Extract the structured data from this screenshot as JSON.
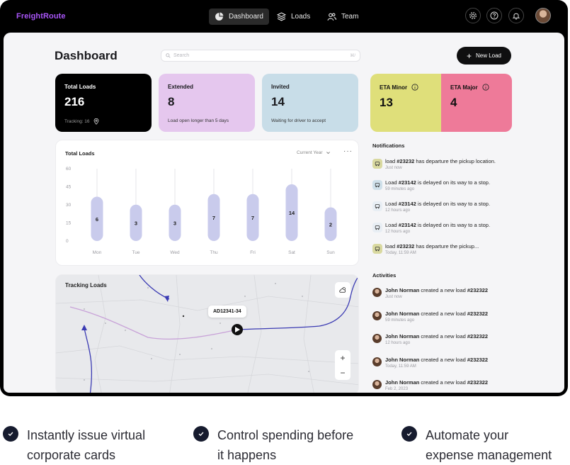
{
  "nav": {
    "brand": "FreightRoute",
    "tabs": [
      {
        "label": "Dashboard",
        "icon": "pie-chart-icon",
        "active": true
      },
      {
        "label": "Loads",
        "icon": "layers-icon",
        "active": false
      },
      {
        "label": "Team",
        "icon": "users-icon",
        "active": false
      }
    ],
    "icons": [
      "gear-icon",
      "help-icon",
      "bell-icon"
    ]
  },
  "header": {
    "title": "Dashboard",
    "search_placeholder": "Search",
    "search_shortcut": "⌘/",
    "new_load_label": "New Load"
  },
  "stats": [
    {
      "label": "Total Loads",
      "value": "216",
      "sub": "Tracking: 16",
      "bg": "#000000",
      "fg": "#ffffff"
    },
    {
      "label": "Extended",
      "value": "8",
      "sub": "Load open longer than 5 days",
      "bg": "#e5c7ee",
      "fg": "#1b1b1f"
    },
    {
      "label": "Invited",
      "value": "14",
      "sub": "Waiting for driver to accept",
      "bg": "#c8dde8",
      "fg": "#1b1b1f"
    }
  ],
  "eta": [
    {
      "label": "ETA Minor",
      "value": "13",
      "bg": "#dfdf7a"
    },
    {
      "label": "ETA Major",
      "value": "4",
      "bg": "#ee7a99"
    }
  ],
  "total_loads_chart": {
    "title": "Total Loads",
    "filter": "Current Year",
    "more": "···"
  },
  "chart_data": {
    "type": "bar",
    "title": "Total Loads",
    "categories": [
      "Mon",
      "Tue",
      "Wed",
      "Thu",
      "Fri",
      "Sat",
      "Sun"
    ],
    "values": [
      6,
      3,
      3,
      7,
      7,
      14,
      2
    ],
    "yticks": [
      0,
      15,
      30,
      45,
      60
    ],
    "ylim": [
      0,
      60
    ],
    "bar_color": "#c9cbec",
    "grid": false
  },
  "map": {
    "title": "Tracking Loads",
    "tooltip": "AD12341-34",
    "zoom_in": "+",
    "zoom_out": "−"
  },
  "notifications": {
    "title": "Notifications",
    "items": [
      {
        "pre": "load ",
        "id": "#23232",
        "post": " has departure the pickup location.",
        "time": "Just now",
        "color": "#d9d9a0"
      },
      {
        "pre": "Load ",
        "id": "#23142",
        "post": " is delayed on its way to a stop.",
        "time": "59 minutes ago",
        "color": "#cfe0ea"
      },
      {
        "pre": "Load ",
        "id": "#23142",
        "post": " is delayed on its way to a stop.",
        "time": "12 hours ago",
        "color": "#e8eef4"
      },
      {
        "pre": "Load ",
        "id": "#23142",
        "post": " is delayed on its way to a stop.",
        "time": "12 hours ago",
        "color": "#e8eef4"
      },
      {
        "pre": "load ",
        "id": "#23232",
        "post": " has departure the pickup...",
        "time": "Today, 11:59 AM",
        "color": "#d9d9a0"
      }
    ]
  },
  "activities": {
    "title": "Activities",
    "items": [
      {
        "name": "John Norman",
        "action": " created a new load ",
        "id": "#232322",
        "time": "Just now"
      },
      {
        "name": "John Norman",
        "action": " created a new load ",
        "id": "#232322",
        "time": "59 minutes ago"
      },
      {
        "name": "John Norman",
        "action": " created a new load ",
        "id": "#232322",
        "time": "12 hours ago"
      },
      {
        "name": "John Norman",
        "action": " created a new load ",
        "id": "#232322",
        "time": "Today, 11:59 AM"
      },
      {
        "name": "John Norman",
        "action": " created a new load ",
        "id": "#232322",
        "time": "Feb 2, 2023"
      }
    ]
  },
  "features": [
    {
      "line1": "Instantly issue virtual",
      "line2": "corporate cards"
    },
    {
      "line1": "Control spending before",
      "line2": "it happens"
    },
    {
      "line1": "Automate your",
      "line2": "expense management"
    }
  ]
}
